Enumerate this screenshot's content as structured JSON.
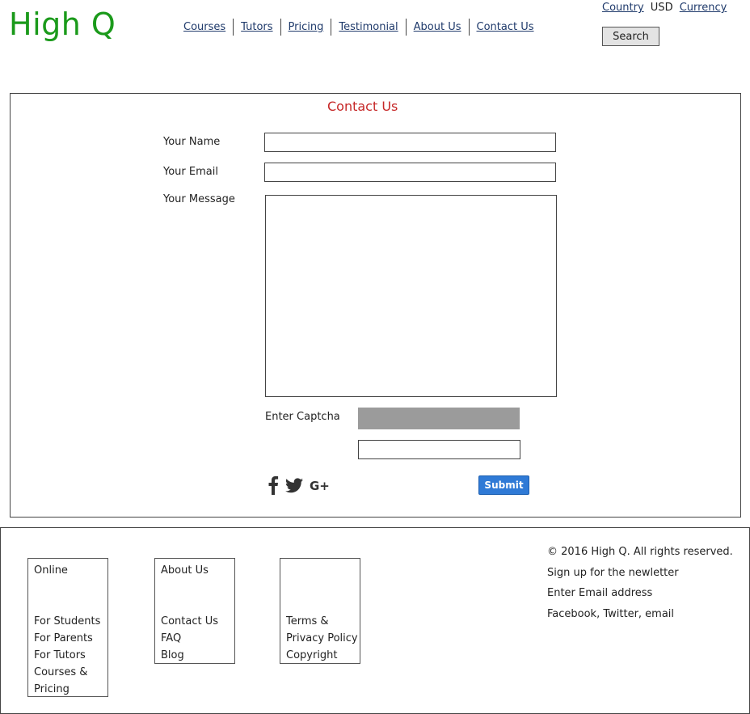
{
  "header": {
    "logo": "High Q",
    "nav": [
      "Courses",
      "Tutors",
      "Pricing",
      "Testimonial",
      "About Us",
      "Contact Us"
    ],
    "country_link": "Country",
    "currency_value": "USD",
    "currency_link": "Currency",
    "search_label": "Search"
  },
  "contact": {
    "title": "Contact Us",
    "name_label": "Your Name",
    "name_value": "",
    "email_label": "Your Email",
    "email_value": "",
    "message_label": "Your Message",
    "message_value": "",
    "captcha_label": "Enter Captcha",
    "captcha_value": "",
    "submit_label": "Submit",
    "social_icons": [
      "facebook-icon",
      "twitter-icon",
      "google-plus-icon"
    ],
    "accent_color": "#c62828",
    "submit_color": "#2f7ad6"
  },
  "footer": {
    "col1": {
      "heading": "Online",
      "links": [
        "For Students",
        "For Parents",
        "For Tutors",
        "Courses &",
        "Pricing"
      ]
    },
    "col2": {
      "heading": "About Us",
      "links": [
        "Contact Us",
        "FAQ",
        "Blog"
      ]
    },
    "col3": {
      "heading": "",
      "links": [
        "Terms &",
        "Privacy Policy",
        "Copyright"
      ]
    },
    "copyright": "© 2016 High Q. All rights reserved.",
    "newsletter": "Sign up for the newletter",
    "email_prompt": "Enter Email address",
    "social_text": "Facebook, Twitter, email"
  },
  "brand_color": "#1b9a1b"
}
